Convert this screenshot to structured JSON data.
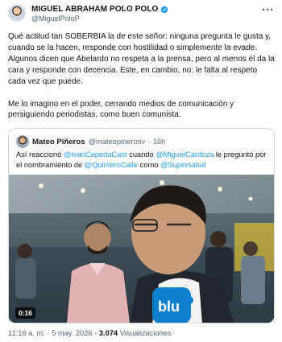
{
  "post": {
    "author_name": "MIGUEL ABRAHAM POLO POLO",
    "author_handle": "@MiguelPoloP",
    "paragraphs": [
      "Qué actitud tan SOBERBIA la de este señor: ninguna pregunta le gusta y, cuando se la hacen, responde con hostilidad o simplemente la evade. Algunos dicen que Abelardo no respeta a la prensa, pero al menos él da la cara y responde con decencia. Este, en cambio, no: le falta al respeto cada vez que puede.",
      "Me lo imagino en el poder, cerrando medios de comunicación y persiguiendo periodistas, como buen comunista."
    ],
    "timestamp": "11:16 a. m. · 5 may. 2026",
    "separator": " · ",
    "views_count": "3.074",
    "views_label": "Visualizaciones"
  },
  "quoted": {
    "author_name": "Mateo Piñeros",
    "author_handle": "@mateopinerosv",
    "time_ago": "· 16h",
    "text_parts": {
      "t1": "Así reaccionó ",
      "m1": "@IvanCepedaCast",
      "t2": " cuando ",
      "m2": "@MiguelCardoza",
      "t3": " le preguntó por el nombramiento de ",
      "m3": "@QuinteroCalle",
      "t4": " como ",
      "m4": "@Supersalud"
    },
    "video_duration": "0:16"
  },
  "colors": {
    "accent": "#1d9bf0",
    "text": "#0f1419",
    "secondary": "#536471",
    "border": "#cfd9de"
  },
  "icons": [
    "avatar",
    "verified-badge-icon",
    "more-options-icon",
    "play-video"
  ]
}
